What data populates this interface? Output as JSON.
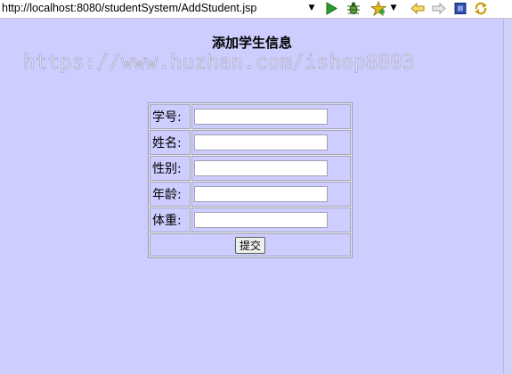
{
  "browser": {
    "url": "http://localhost:8080/studentSystem/AddStudent.jsp",
    "url_dropdown": "▼",
    "favorites_dropdown": "▼"
  },
  "page": {
    "title": "添加学生信息",
    "watermark": "https://www.huzhan.com/ishop8803"
  },
  "form": {
    "fields": [
      {
        "label": "学号:",
        "value": ""
      },
      {
        "label": "姓名:",
        "value": ""
      },
      {
        "label": "性别:",
        "value": ""
      },
      {
        "label": "年龄:",
        "value": ""
      },
      {
        "label": "体重:",
        "value": ""
      }
    ],
    "submit_label": "提交"
  },
  "colors": {
    "page_background": "#cdcdff",
    "go_green": "#2c9a2c",
    "nav_yellow": "#e8b820",
    "stop_blue": "#3050b0"
  },
  "icons": [
    "go-icon",
    "debug-bug-icon",
    "favorites-star-icon",
    "back-arrow-icon",
    "forward-arrow-icon",
    "stop-icon",
    "refresh-icon"
  ]
}
